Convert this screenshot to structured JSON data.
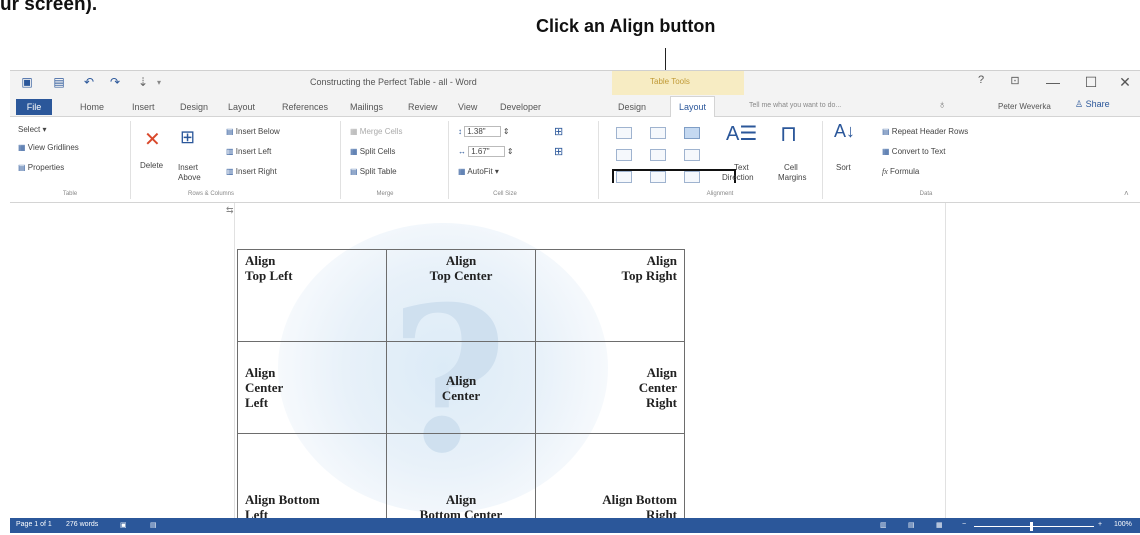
{
  "callout": {
    "top_fragment": "ur screen).",
    "text": "Click an Align button"
  },
  "window": {
    "title": "Constructing the Perfect Table - all - Word",
    "table_tools": "Table Tools",
    "help_icon": "?",
    "minimize": "—",
    "maximize": "☐",
    "close": "✕"
  },
  "tabs": {
    "file": "File",
    "items": [
      "Home",
      "Insert",
      "Design",
      "Layout",
      "References",
      "Mailings",
      "Review",
      "View",
      "Developer"
    ],
    "context": [
      "Design",
      "Layout"
    ],
    "tell_me": "Tell me what you want to do...",
    "user": "Peter Weverka",
    "share": "Share"
  },
  "ribbon": {
    "table": {
      "select": "Select ▾",
      "view_gridlines": "View Gridlines",
      "properties": "Properties",
      "label": "Table"
    },
    "rows_columns": {
      "delete": "Delete",
      "insert_above_1": "Insert",
      "insert_above_2": "Above",
      "insert_below": "Insert Below",
      "insert_left": "Insert Left",
      "insert_right": "Insert Right",
      "label": "Rows & Columns"
    },
    "merge": {
      "merge_cells": "Merge Cells",
      "split_cells": "Split Cells",
      "split_table": "Split Table",
      "label": "Merge"
    },
    "cell_size": {
      "height": "1.38\"",
      "width": "1.67\"",
      "autofit": "AutoFit ▾",
      "label": "Cell Size"
    },
    "alignment": {
      "text_direction_1": "Text",
      "text_direction_2": "Direction",
      "cell_margins_1": "Cell",
      "cell_margins_2": "Margins",
      "label": "Alignment",
      "selected_button": "Align Top Right"
    },
    "data": {
      "sort": "Sort",
      "repeat_header_rows": "Repeat Header Rows",
      "convert_to_text": "Convert to Text",
      "formula": "Formula",
      "label": "Data"
    }
  },
  "table_cells": [
    [
      "Align\nTop Left",
      "Align\nTop Center",
      "Align\nTop Right"
    ],
    [
      "Align\nCenter\nLeft",
      "Align\nCenter",
      "Align\nCenter\nRight"
    ],
    [
      "Align Bottom\nLeft",
      "Align\nBottom Center",
      "Align Bottom\nRight"
    ]
  ],
  "status": {
    "page": "Page 1 of 1",
    "words": "276 words",
    "zoom": "100%"
  },
  "colors": {
    "word_blue": "#2b579a",
    "table_tools_bg": "#f7ecc3",
    "table_tools_text": "#c09a36"
  }
}
